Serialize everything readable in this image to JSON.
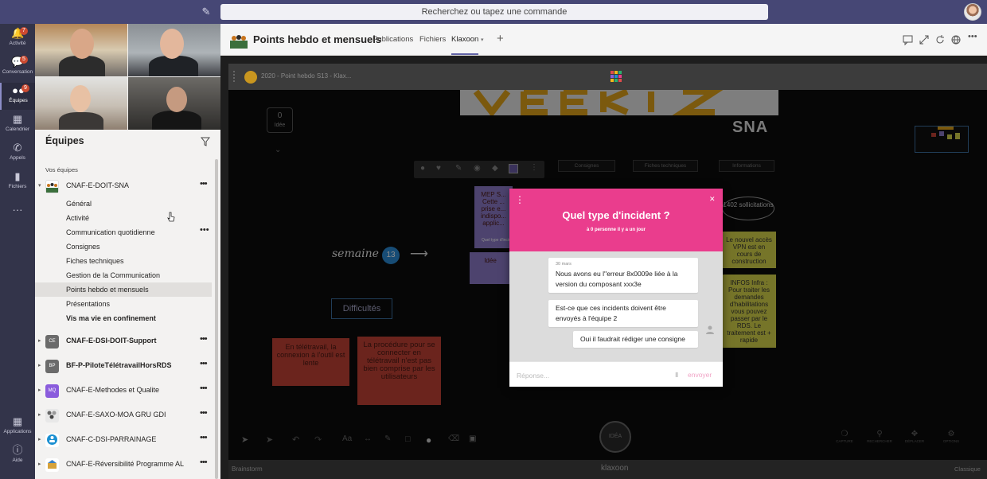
{
  "topbar": {
    "search_placeholder": "Recherchez ou tapez une commande",
    "compose_icon": "compose-icon",
    "avatar_icon": "user-avatar"
  },
  "rail": {
    "items": [
      {
        "label": "Activité",
        "icon": "bell-icon",
        "badge": "7"
      },
      {
        "label": "Conversation",
        "icon": "chat-icon",
        "badge": "5"
      },
      {
        "label": "Équipes",
        "icon": "teams-icon",
        "badge": "9"
      },
      {
        "label": "Calendrier",
        "icon": "calendar-icon",
        "badge": ""
      },
      {
        "label": "Appels",
        "icon": "phone-icon",
        "badge": ""
      },
      {
        "label": "Fichiers",
        "icon": "file-icon",
        "badge": ""
      },
      {
        "label": "···",
        "icon": "more-icon",
        "badge": ""
      },
      {
        "label": "Applications",
        "icon": "apps-icon",
        "badge": ""
      },
      {
        "label": "Aide",
        "icon": "help-icon",
        "badge": ""
      }
    ]
  },
  "panel": {
    "title": "Équipes",
    "section_label": "Vos équipes",
    "teams": [
      {
        "name": "CNAF-E-DOIT-SNA",
        "logo": "",
        "bold": false
      },
      {
        "name": "CNAF-E-DSI-DOIT-Support",
        "logo": "CE",
        "bold": true
      },
      {
        "name": "BF-P-PiloteTélétravailHorsRDS",
        "logo": "BP",
        "bold": true
      },
      {
        "name": "CNAF-E-Methodes et Qualite",
        "logo": "MQ",
        "bold": false
      },
      {
        "name": "CNAF-E-SAXO-MOA GRU GDI",
        "logo": "",
        "bold": false
      },
      {
        "name": "CNAF-C-DSI-PARRAINAGE",
        "logo": "",
        "bold": false
      },
      {
        "name": "CNAF-E-Réversibilité Programme AL",
        "logo": "",
        "bold": false
      }
    ],
    "channels": [
      {
        "name": "Général"
      },
      {
        "name": "Activité"
      },
      {
        "name": "Communication quotidienne"
      },
      {
        "name": "Consignes"
      },
      {
        "name": "Fiches techniques"
      },
      {
        "name": "Gestion de la Communication"
      },
      {
        "name": "Points hebdo et mensuels"
      },
      {
        "name": "Présentations"
      },
      {
        "name": "Vis ma vie en confinement"
      }
    ]
  },
  "main": {
    "channel_title": "Points hebdo et mensuels",
    "tabs": [
      "Publications",
      "Fichiers",
      "Klaxoon"
    ],
    "active_tab": "Klaxoon",
    "klaxoon": {
      "room_title": "2020 - Point hebdo S13 - Klax...",
      "counter_value": "0",
      "counter_label": "Idée",
      "banner_text": "SNA",
      "week_label": "semaine",
      "week_number": "13",
      "difficulties_label": "Difficultés",
      "columns": [
        "Consignes",
        "Fiches techniques",
        "Informations"
      ],
      "solicitations": "1402 sollicitations",
      "note_left_1": "En télétravail, la connexion à l'outil est lente",
      "note_left_2": "La procédure pour se connecter en télétravail n'est pas bien comprise par les utilisateurs",
      "note_left_label": "MEP S... Cette ... prise e... indispo... applic...",
      "note_mid_label": "Quel type d'incident",
      "note_idee": "Idée",
      "note_vpn": "Le nouvel accès VPN est en cours de construction",
      "note_infos": "INFOS Infra : Pour traiter les demandes d'habilitations vous pouvez passer par le RDS. Le traitement est + rapide",
      "idea_button": "IDÉA",
      "right_tools": [
        "CAPTURE",
        "RECHERCHER",
        "DÉPLACER",
        "OPTIONS"
      ],
      "bottom_left": "Brainstorm",
      "bottom_mid": "klaxoon",
      "bottom_right": "Classique"
    },
    "modal": {
      "title": "Quel type d'incident ?",
      "subtitle": "à 0 personne il y a un jour",
      "date": "30 mars",
      "messages": [
        "Nous avons eu l''erreur 8x0009e liée à la version du composant xxx3e",
        "Est-ce que ces incidents doivent être envoyés à l'équipe 2",
        "Oui il faudrait rédiger une consigne"
      ],
      "reply_placeholder": "Réponse...",
      "send_label": "envoyer"
    }
  },
  "colors": {
    "teams_purple": "#464775",
    "rail": "#33344a",
    "accent": "#6264a7",
    "modal_pink": "#ea3d8d",
    "badge_red": "#cc4a31"
  }
}
